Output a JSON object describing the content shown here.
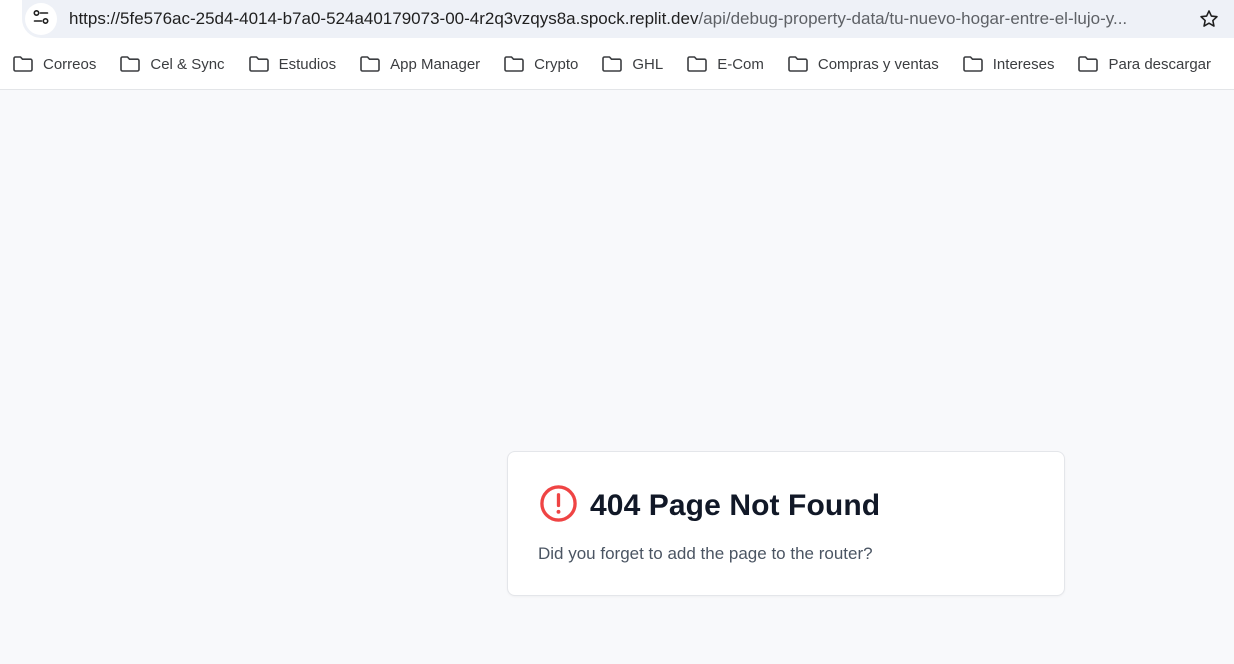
{
  "browser": {
    "url_host": "https://5fe576ac-25d4-4014-b7a0-524a40179073-00-4r2q3vzqys8a.spock.replit.dev",
    "url_path": "/api/debug-property-data/tu-nuevo-hogar-entre-el-lujo-y...",
    "bookmarks": [
      {
        "label": "Correos"
      },
      {
        "label": "Cel & Sync"
      },
      {
        "label": "Estudios"
      },
      {
        "label": "App Manager"
      },
      {
        "label": "Crypto"
      },
      {
        "label": "GHL"
      },
      {
        "label": "E-Com"
      },
      {
        "label": "Compras y ventas"
      },
      {
        "label": "Intereses"
      },
      {
        "label": "Para descargar"
      },
      {
        "label": ""
      }
    ],
    "icons": {
      "site_info": "tune-icon",
      "bookmark_star": "star-icon",
      "bookmark_folder": "folder-icon"
    }
  },
  "page": {
    "error_title": "404 Page Not Found",
    "error_message": "Did you forget to add the page to the router?",
    "error_icon": "alert-circle-icon",
    "colors": {
      "background": "#f8f9fb",
      "error_accent": "#ef4444",
      "title": "#111827",
      "message": "#4b5563"
    }
  }
}
